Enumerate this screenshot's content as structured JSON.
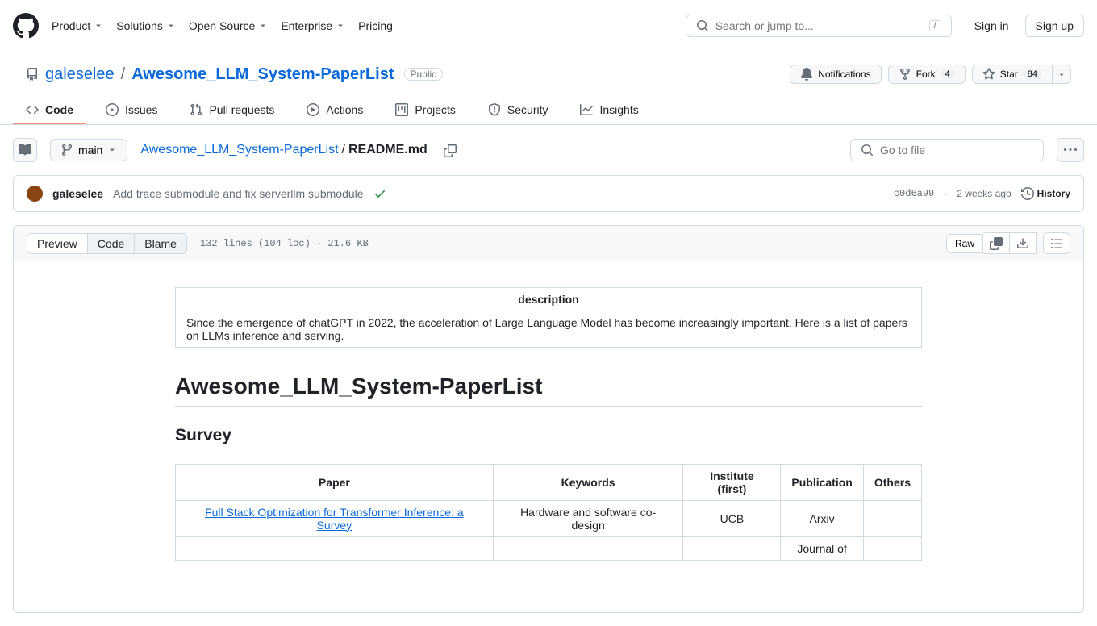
{
  "header": {
    "nav": [
      "Product",
      "Solutions",
      "Open Source",
      "Enterprise",
      "Pricing"
    ],
    "search_placeholder": "Search or jump to...",
    "slash": "/",
    "sign_in": "Sign in",
    "sign_up": "Sign up"
  },
  "repo": {
    "owner": "galeselee",
    "sep": "/",
    "name": "Awesome_LLM_System-PaperList",
    "visibility": "Public",
    "notifications": "Notifications",
    "fork": "Fork",
    "fork_count": "4",
    "star": "Star",
    "star_count": "84"
  },
  "repo_nav": [
    "Code",
    "Issues",
    "Pull requests",
    "Actions",
    "Projects",
    "Security",
    "Insights"
  ],
  "file_nav": {
    "branch": "main",
    "breadcrumb_repo": "Awesome_LLM_System-PaperList",
    "breadcrumb_sep": "/",
    "breadcrumb_file": "README.md",
    "go_to_file": "Go to file"
  },
  "commit": {
    "author": "galeselee",
    "message": "Add trace submodule and fix serverllm submodule",
    "hash": "c0d6a99",
    "dot": "·",
    "time": "2 weeks ago",
    "history": "History"
  },
  "file_toolbar": {
    "tabs": [
      "Preview",
      "Code",
      "Blame"
    ],
    "info": "132 lines (104 loc) · 21.6 KB",
    "raw": "Raw"
  },
  "readme": {
    "desc_header": "description",
    "desc_body": "Since the emergence of chatGPT in 2022, the acceleration of Large Language Model has become increasingly important. Here is a list of papers on LLMs inference and serving.",
    "h1": "Awesome_LLM_System-PaperList",
    "h2": "Survey",
    "survey_headers": [
      "Paper",
      "Keywords",
      "Institute (first)",
      "Publication",
      "Others"
    ],
    "survey_rows": [
      {
        "paper": "Full Stack Optimization for Transformer Inference: a Survey",
        "keywords": "Hardware and software co-design",
        "institute": "UCB",
        "publication": "Arxiv",
        "others": ""
      }
    ],
    "partial_row": "Journal of"
  }
}
